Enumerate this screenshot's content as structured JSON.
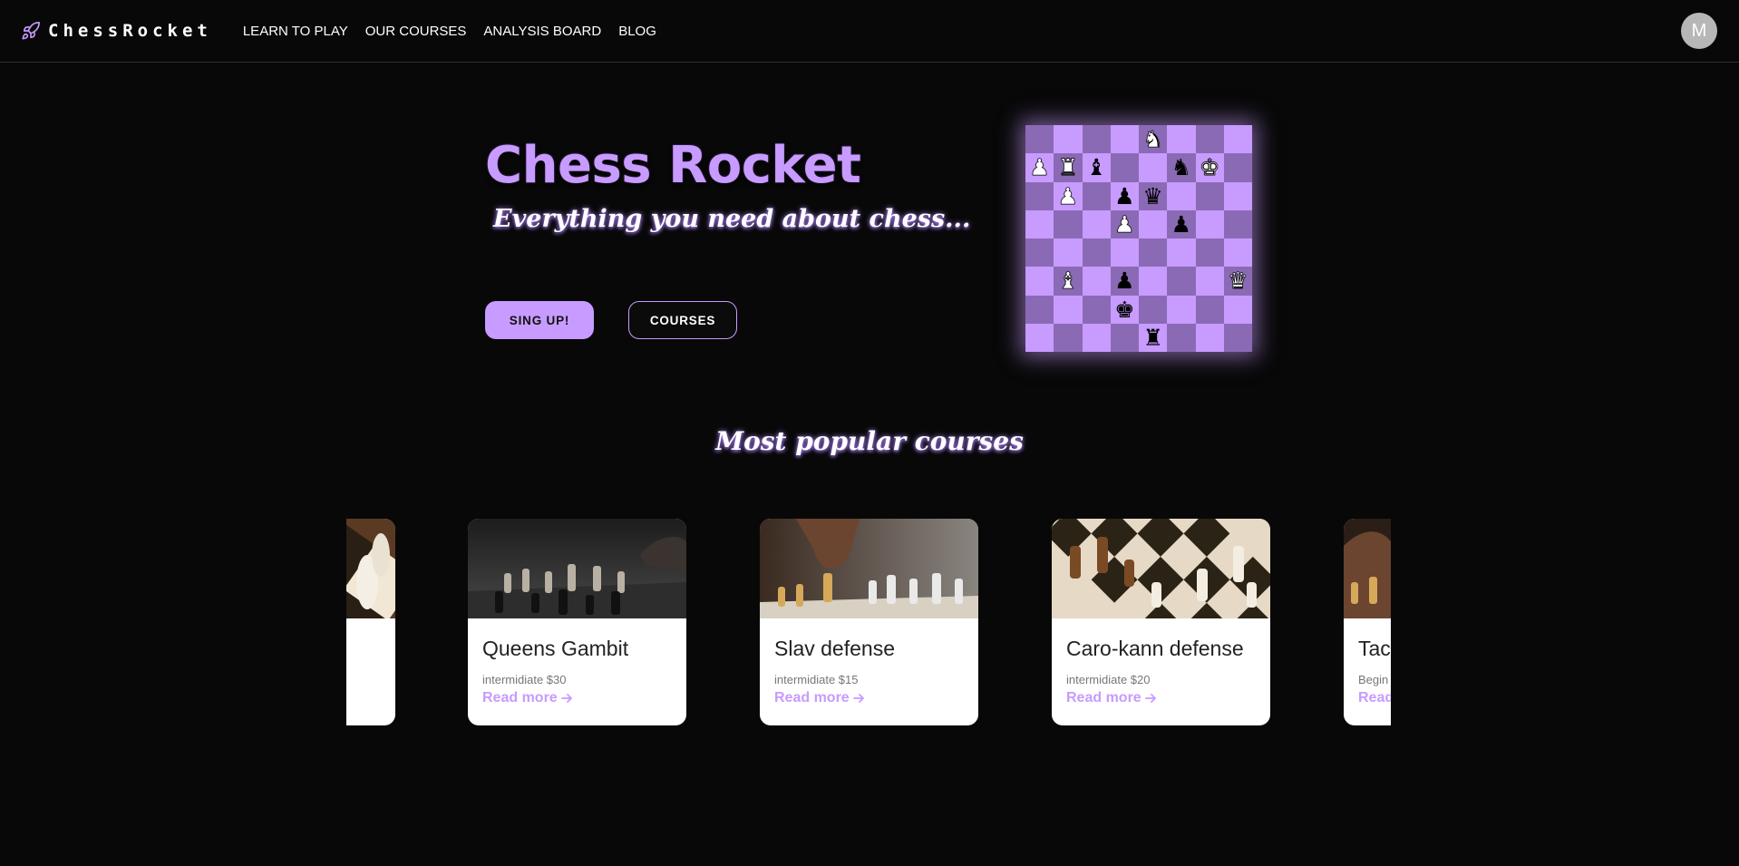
{
  "nav": {
    "brand": "ChessRocket",
    "links": [
      "LEARN TO PLAY",
      "OUR COURSES",
      "ANALYSIS BOARD",
      "BLOG"
    ],
    "avatar_initial": "M",
    "icon": "rocket-icon"
  },
  "hero": {
    "title": "Chess Rocket",
    "subtitle": "Everything you need about chess...",
    "signup_label": "SING UP!",
    "courses_label": "COURSES"
  },
  "colors": {
    "accent": "#c79bff",
    "board_light": "#c89bff",
    "board_dark": "#8b6ab5",
    "background": "#080808"
  },
  "board": {
    "rows": [
      [
        "",
        "",
        "",
        "",
        "wN",
        "",
        "",
        ""
      ],
      [
        "wP",
        "wR",
        "bB",
        "",
        "",
        "bN",
        "wK",
        ""
      ],
      [
        "",
        "wP",
        "",
        "bP",
        "bQ",
        "",
        "",
        ""
      ],
      [
        "",
        "",
        "",
        "wP",
        "",
        "bP",
        "",
        ""
      ],
      [
        "",
        "",
        "",
        "",
        "",
        "",
        "",
        ""
      ],
      [
        "",
        "wB",
        "",
        "bP",
        "",
        "",
        "",
        "wQ"
      ],
      [
        "",
        "",
        "",
        "bK",
        "",
        "",
        "",
        ""
      ],
      [
        "",
        "",
        "",
        "",
        "bR",
        "",
        "",
        ""
      ]
    ]
  },
  "popular": {
    "title": "Most popular courses",
    "cards": [
      {
        "title": "",
        "meta": "",
        "link": ""
      },
      {
        "title": "Queens Gambit",
        "meta": "intermidiate $30",
        "link": "Read more"
      },
      {
        "title": "Slav defense",
        "meta": "intermidiate $15",
        "link": "Read more"
      },
      {
        "title": "Caro-kann defense",
        "meta": "intermidiate $20",
        "link": "Read more"
      },
      {
        "title": "Tac",
        "meta": "Begin",
        "link": "Read"
      }
    ]
  }
}
